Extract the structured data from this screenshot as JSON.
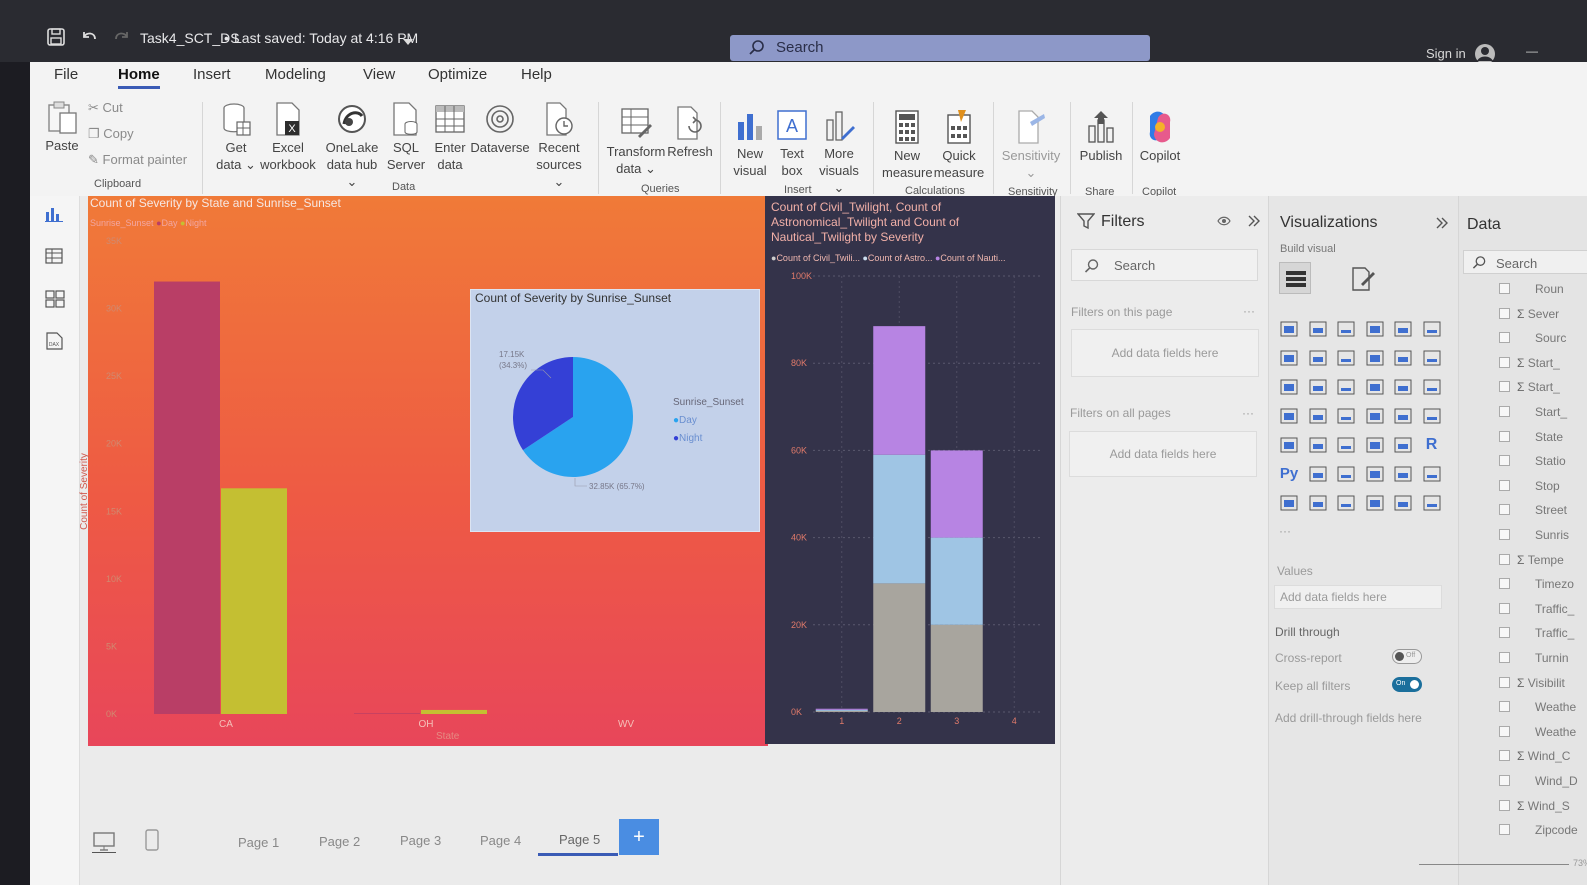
{
  "titlebar": {
    "file_title": "Task4_SCT_DS",
    "saved": "Last saved: Today at 4:16 PM",
    "search": "Search",
    "sign_in": "Sign in",
    "minimize": "—"
  },
  "ribbon": {
    "tabs": [
      "File",
      "Home",
      "Insert",
      "Modeling",
      "View",
      "Optimize",
      "Help"
    ],
    "clipboard": {
      "paste": "Paste",
      "cut": "Cut",
      "copy": "Copy",
      "format_painter": "Format painter",
      "group": "Clipboard"
    },
    "data": {
      "get_data": [
        "Get",
        "data ⌄"
      ],
      "excel": [
        "Excel",
        "workbook"
      ],
      "onelake": [
        "OneLake",
        "data hub ⌄"
      ],
      "sql": [
        "SQL",
        "Server"
      ],
      "enter": [
        "Enter",
        "data"
      ],
      "dataverse": "Dataverse",
      "recent": [
        "Recent",
        "sources ⌄"
      ],
      "group": "Data"
    },
    "queries": {
      "transform": [
        "Transform",
        "data ⌄"
      ],
      "refresh": "Refresh",
      "group": "Queries"
    },
    "insert": {
      "new_visual": [
        "New",
        "visual"
      ],
      "text_box": [
        "Text",
        "box"
      ],
      "more_visuals": [
        "More",
        "visuals ⌄"
      ],
      "group": "Insert"
    },
    "calculations": {
      "new_measure": [
        "New",
        "measure"
      ],
      "quick_measure": [
        "Quick",
        "measure"
      ],
      "group": "Calculations"
    },
    "sensitivity": {
      "label": "Sensitivity",
      "sub": "⌄",
      "group": "Sensitivity"
    },
    "share": {
      "publish": "Publish",
      "group": "Share"
    },
    "copilot": {
      "label": "Copilot",
      "group": "Copilot"
    }
  },
  "colors": {
    "day": "#b93e66",
    "night": "#c4bf32",
    "pie_day": "#29a3ef",
    "pie_night": "#3440d6",
    "civil": "#a8a59e",
    "astro": "#9fc5e4",
    "nautical": "#b784e3"
  },
  "chart_data": [
    {
      "type": "bar",
      "title": "Count of Severity by State and Sunrise_Sunset",
      "legend_title": "Sunrise_Sunset",
      "xlabel": "State",
      "ylabel": "Count of Severity",
      "categories": [
        "CA",
        "OH",
        "WV"
      ],
      "series": [
        {
          "name": "Day",
          "values": [
            32000,
            50,
            0
          ]
        },
        {
          "name": "Night",
          "values": [
            16700,
            300,
            0
          ]
        }
      ],
      "yticks": [
        "0K",
        "5K",
        "10K",
        "15K",
        "20K",
        "25K",
        "30K",
        "35K"
      ],
      "ylim": [
        0,
        35000
      ]
    },
    {
      "type": "pie",
      "title": "Count of Severity by Sunrise_Sunset",
      "legend_title": "Sunrise_Sunset",
      "slices": [
        {
          "name": "Day",
          "value": 32850,
          "label": "32.85K (65.7%)"
        },
        {
          "name": "Night",
          "value": 17150,
          "label_value": "17.15K",
          "label_pct": "(34.3%)"
        }
      ]
    },
    {
      "type": "bar",
      "stacked": true,
      "title_lines": [
        "Count of Civil_Twilight, Count of",
        "Astronomical_Twilight and Count of",
        "Nautical_Twilight by Severity"
      ],
      "legend": [
        "Count of Civil_Twili...",
        "Count of Astro...",
        "Count of Nauti..."
      ],
      "categories": [
        "1",
        "2",
        "3",
        "4"
      ],
      "series": [
        {
          "name": "Count of Civil_Twilight",
          "values": [
            250,
            29500,
            20000,
            0
          ]
        },
        {
          "name": "Count of Astronomical_Twilight",
          "values": [
            250,
            29500,
            20000,
            0
          ]
        },
        {
          "name": "Count of Nautical_Twilight",
          "values": [
            250,
            29500,
            20000,
            0
          ]
        }
      ],
      "yticks": [
        "0K",
        "20K",
        "40K",
        "60K",
        "80K",
        "100K"
      ],
      "ylim": [
        0,
        100000
      ]
    }
  ],
  "filters": {
    "title": "Filters",
    "search": "Search",
    "on_page": "Filters on this page",
    "on_all": "Filters on all pages",
    "add_fields": "Add data fields here",
    "more": "···"
  },
  "viz": {
    "title": "Visualizations",
    "build": "Build visual",
    "values": "Values",
    "add_fields": "Add data fields here",
    "drill": "Drill through",
    "cross_report": "Cross-report",
    "cross_state": "Off",
    "keep_filters": "Keep all filters",
    "keep_state": "On",
    "add_drill": "Add drill-through fields here",
    "r_icon": "R",
    "py_icon": "Py",
    "more": "···"
  },
  "data_pane": {
    "title": "Data",
    "search": "Search",
    "fields": [
      {
        "sigma": false,
        "label": "Roun"
      },
      {
        "sigma": true,
        "label": "Sever"
      },
      {
        "sigma": false,
        "label": "Sourc"
      },
      {
        "sigma": true,
        "label": "Start_"
      },
      {
        "sigma": true,
        "label": "Start_"
      },
      {
        "sigma": false,
        "label": "Start_"
      },
      {
        "sigma": false,
        "label": "State"
      },
      {
        "sigma": false,
        "label": "Statio"
      },
      {
        "sigma": false,
        "label": "Stop"
      },
      {
        "sigma": false,
        "label": "Street"
      },
      {
        "sigma": false,
        "label": "Sunris"
      },
      {
        "sigma": true,
        "label": "Tempe"
      },
      {
        "sigma": false,
        "label": "Timezo"
      },
      {
        "sigma": false,
        "label": "Traffic_"
      },
      {
        "sigma": false,
        "label": "Traffic_"
      },
      {
        "sigma": false,
        "label": "Turnin"
      },
      {
        "sigma": true,
        "label": "Visibilit"
      },
      {
        "sigma": false,
        "label": "Weathe"
      },
      {
        "sigma": false,
        "label": "Weathe"
      },
      {
        "sigma": true,
        "label": "Wind_C"
      },
      {
        "sigma": false,
        "label": "Wind_D"
      },
      {
        "sigma": true,
        "label": "Wind_S"
      },
      {
        "sigma": false,
        "label": "Zipcode"
      }
    ],
    "zoom": "73%"
  },
  "pages": [
    "Page 1",
    "Page 2",
    "Page 3",
    "Page 4",
    "Page 5"
  ],
  "add_page": "+"
}
